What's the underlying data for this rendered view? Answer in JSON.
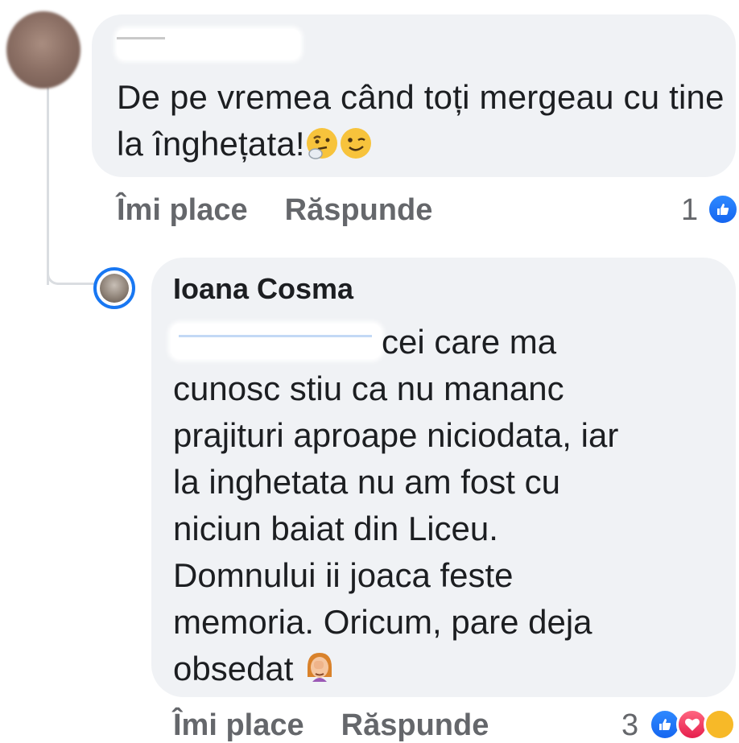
{
  "comment1": {
    "author": "",
    "text": "De pe vremea când toți mergeau cu tine la înghețata!",
    "emojis": [
      "thinking-face-icon",
      "winking-face-icon"
    ],
    "like_label": "Îmi place",
    "reply_label": "Răspunde",
    "reaction_count": "1",
    "reactions": [
      "like-icon"
    ]
  },
  "reply1": {
    "author": "Ioana Cosma",
    "lines": [
      "cei care ma",
      "cunosc stiu ca nu mananc",
      "prajituri aproape niciodata, iar",
      "la inghetata nu am fost cu",
      "niciun baiat din Liceu.",
      "Domnului ii joaca feste",
      "memoria. Oricum, pare deja",
      "obsedat"
    ],
    "emoji_end": "woman-facepalming-icon",
    "like_label": "Îmi place",
    "reply_label": "Răspunde",
    "reaction_count": "3",
    "reactions": [
      "like-icon",
      "love-icon",
      "care-icon"
    ]
  },
  "colors": {
    "bubble": "#f0f2f5",
    "text": "#1c1e21",
    "secondary": "#65676b",
    "accent": "#1877f2"
  }
}
